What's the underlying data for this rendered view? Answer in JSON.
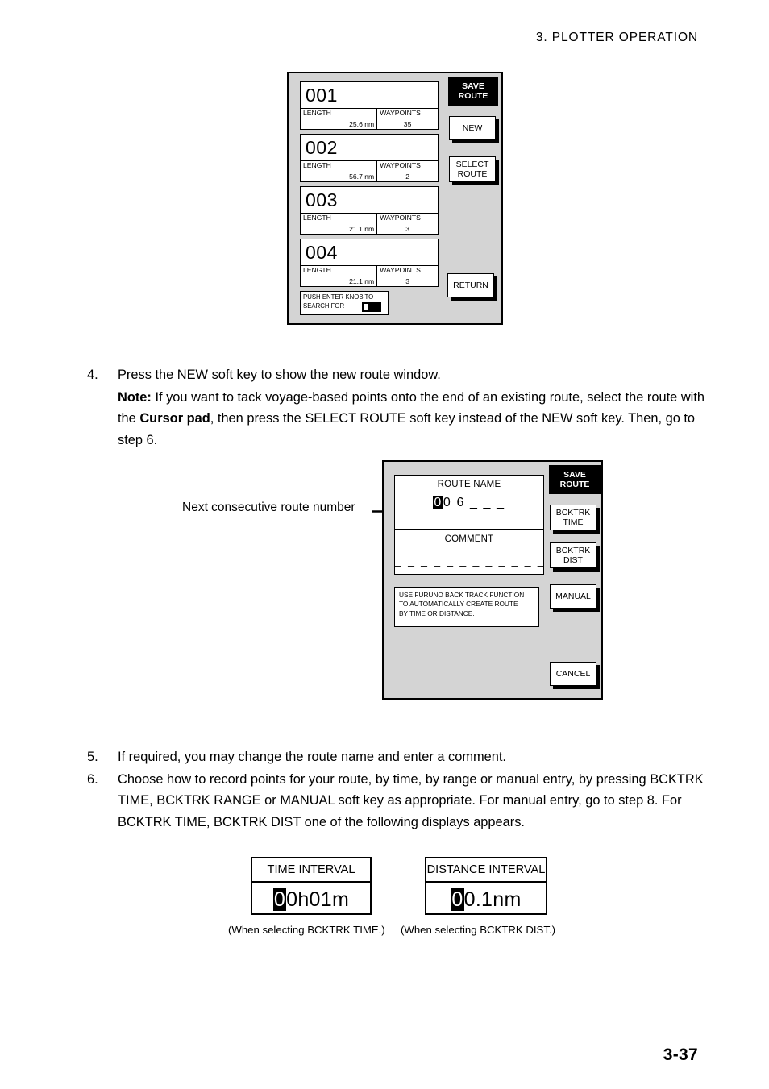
{
  "header": {
    "title": "3.  PLOTTER  OPERATION"
  },
  "footer": {
    "page_number": "3-37"
  },
  "figure_route_list": {
    "title_key": {
      "line1": "SAVE",
      "line2": "ROUTE"
    },
    "softkeys": [
      {
        "line1": "NEW",
        "line2": ""
      },
      {
        "line1": "SELECT",
        "line2": "ROUTE"
      },
      {
        "line1": "RETURN",
        "line2": ""
      }
    ],
    "length_label": "LENGTH",
    "waypoints_label": "WAYPOINTS",
    "routes": [
      {
        "name": "001",
        "length": "25.6 nm",
        "waypoints": "35"
      },
      {
        "name": "002",
        "length": "56.7 nm",
        "waypoints": "2"
      },
      {
        "name": "003",
        "length": "21.1 nm",
        "waypoints": "3"
      },
      {
        "name": "004",
        "length": "21.1 nm",
        "waypoints": "3"
      }
    ],
    "search_prompt": {
      "line1": "PUSH ENTER KNOB TO",
      "line2": "SEARCH FOR"
    }
  },
  "figure_new_route": {
    "title_key": {
      "line1": "SAVE",
      "line2": "ROUTE"
    },
    "softkeys": [
      {
        "line1": "BCKTRK",
        "line2": "TIME"
      },
      {
        "line1": "BCKTRK",
        "line2": "DIST"
      },
      {
        "line1": "MANUAL",
        "line2": ""
      },
      {
        "line1": "CANCEL",
        "line2": ""
      }
    ],
    "route_name_label": "ROUTE NAME",
    "route_name_cursor_char": "0",
    "route_name_rest": "0 6 _ _ _",
    "comment_label": "COMMENT",
    "comment_dashes": "_ _ _ _ _ _ _ _ _ _ _ _",
    "hint": {
      "line1": "USE FURUNO BACK TRACK FUNCTION",
      "line2": "TO AUTOMATICALLY CREATE ROUTE",
      "line3": "BY TIME OR DISTANCE."
    },
    "annotation": "Next consecutive route number"
  },
  "steps_first": [
    {
      "number": "4.",
      "text": "Press the NEW soft key to show the new route window.",
      "note_prefix": "Note:",
      "note_part1": " If you want to tack voyage-based points onto the end of an existing route, select the route with the ",
      "note_bold2": "Cursor pad",
      "note_part2": ", then press the SELECT ROUTE soft key instead of the NEW soft key. Then, go to step 6."
    }
  ],
  "steps_second": [
    {
      "number": "5.",
      "text": "If required, you may change the route name and enter a comment."
    },
    {
      "number": "6.",
      "text": "Choose how to record points for your route, by time, by range or manual entry, by pressing BCKTRK TIME, BCKTRK RANGE or MANUAL soft key as appropriate. For manual entry, go to step 8. For BCKTRK TIME, BCKTRK DIST one of the following displays appears."
    }
  ],
  "interval_time": {
    "title": "TIME INTERVAL",
    "cursor_char": "0",
    "value_rest": "0h01m",
    "caption": "(When selecting BCKTRK TIME.)"
  },
  "interval_distance": {
    "title": "DISTANCE INTERVAL",
    "cursor_char": "0",
    "value_rest": "0.1nm",
    "caption": "(When selecting BCKTRK DIST.)"
  }
}
